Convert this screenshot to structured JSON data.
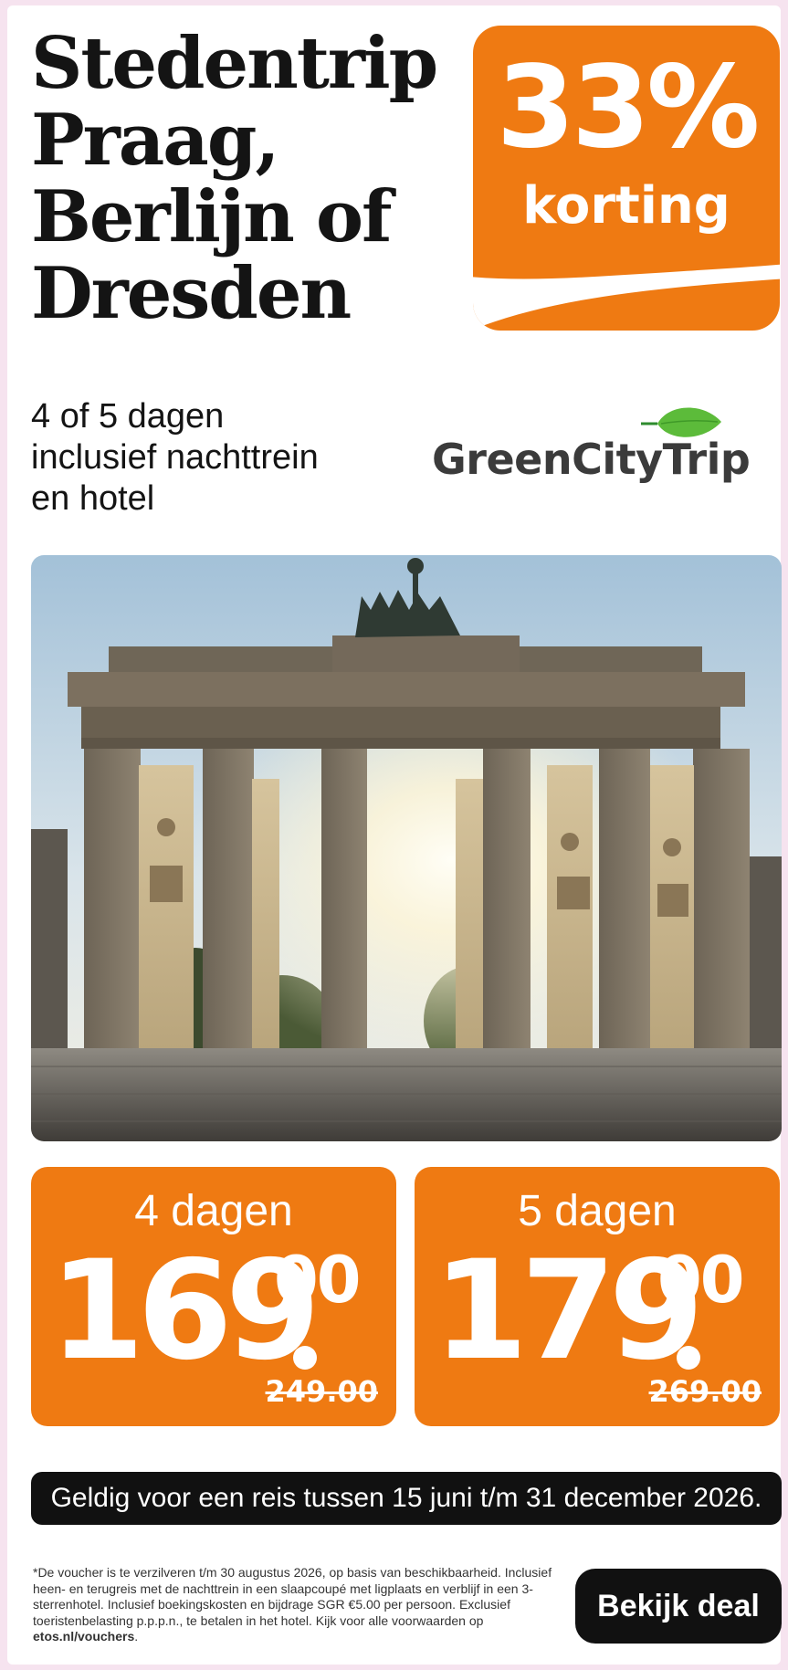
{
  "headline": {
    "lines": [
      "Stedentrip",
      "Praag,",
      "Berlijn of",
      "Dresden"
    ]
  },
  "discount": {
    "value": "33%",
    "label": "korting"
  },
  "subtitle": {
    "lines": [
      "4 of 5 dagen",
      "inclusief nachttrein",
      "en hotel"
    ]
  },
  "brand": {
    "name": "GreenCityTrip",
    "icon": "leaf-icon"
  },
  "photo": {
    "icon": "brandenburg-gate-photo"
  },
  "offers": [
    {
      "days": "4 dagen",
      "price_main": "169",
      "price_cents": "00",
      "old_price": "249.00"
    },
    {
      "days": "5 dagen",
      "price_main": "179",
      "price_cents": "00",
      "old_price": "269.00"
    }
  ],
  "validity": "Geldig voor een reis tussen 15 juni t/m 31 december 2026.",
  "fine_print": {
    "text": "*De voucher is te verzilveren t/m 30 augustus 2026, op basis van beschikbaarheid. Inclusief heen- en terugreis met de nachttrein in een slaapcoupé met ligplaats en verblijf in een 3-sterrenhotel. Inclusief boekingskosten en bijdrage SGR €5.00 per persoon. Exclusief toeristenbelasting p.p.p.n., te betalen in het hotel. Kijk voor alle voorwaarden op ",
    "link": "etos.nl/vouchers",
    "end": "."
  },
  "cta": {
    "label": "Bekijk deal"
  },
  "colors": {
    "accent": "#ef7a12",
    "dark": "#111111",
    "brand_green": "#4caf3a",
    "page_bg": "#f6e3ef"
  }
}
